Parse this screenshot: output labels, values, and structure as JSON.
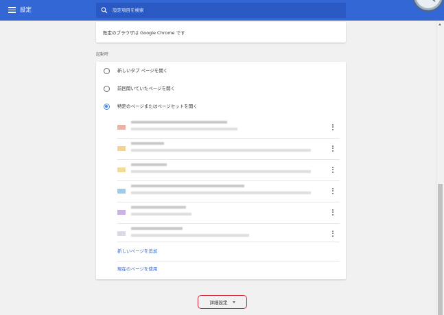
{
  "header": {
    "title": "設定",
    "search_placeholder": "設定項目を検索",
    "icons": {
      "menu": "menu-icon",
      "search": "search-icon",
      "clock": "clock-icon"
    },
    "colors": {
      "bar": "#3367d6",
      "search_bg": "#2b59c3"
    }
  },
  "default_browser": {
    "text": "既定のブラウザは Google Chrome です"
  },
  "startup": {
    "section_title": "起動時",
    "options": [
      {
        "label": "新しいタブ ページを開く",
        "checked": false
      },
      {
        "label": "前回開いていたページを開く",
        "checked": false
      },
      {
        "label": "特定のページまたはページセットを開く",
        "checked": true
      }
    ],
    "pages": [
      {
        "favicon_color": "#e8b4a8",
        "more_icon": "more-vert-icon"
      },
      {
        "favicon_color": "#f6d38f",
        "more_icon": "more-vert-icon"
      },
      {
        "favicon_color": "#f3dc9b",
        "more_icon": "more-vert-icon"
      },
      {
        "favicon_color": "#9ccbee",
        "more_icon": "more-vert-icon"
      },
      {
        "favicon_color": "#c9b3e3",
        "more_icon": "more-vert-icon"
      },
      {
        "favicon_color": "#d8d8e6",
        "more_icon": "more-vert-icon"
      }
    ],
    "add_page_link": "新しいページを追加",
    "use_current_link": "現在のページを使用",
    "accent_color": "#4285f4",
    "link_color": "#3367d6"
  },
  "advanced": {
    "label": "詳細設定",
    "icon": "arrow-drop-down-icon",
    "highlight_color": "#d6243a"
  }
}
